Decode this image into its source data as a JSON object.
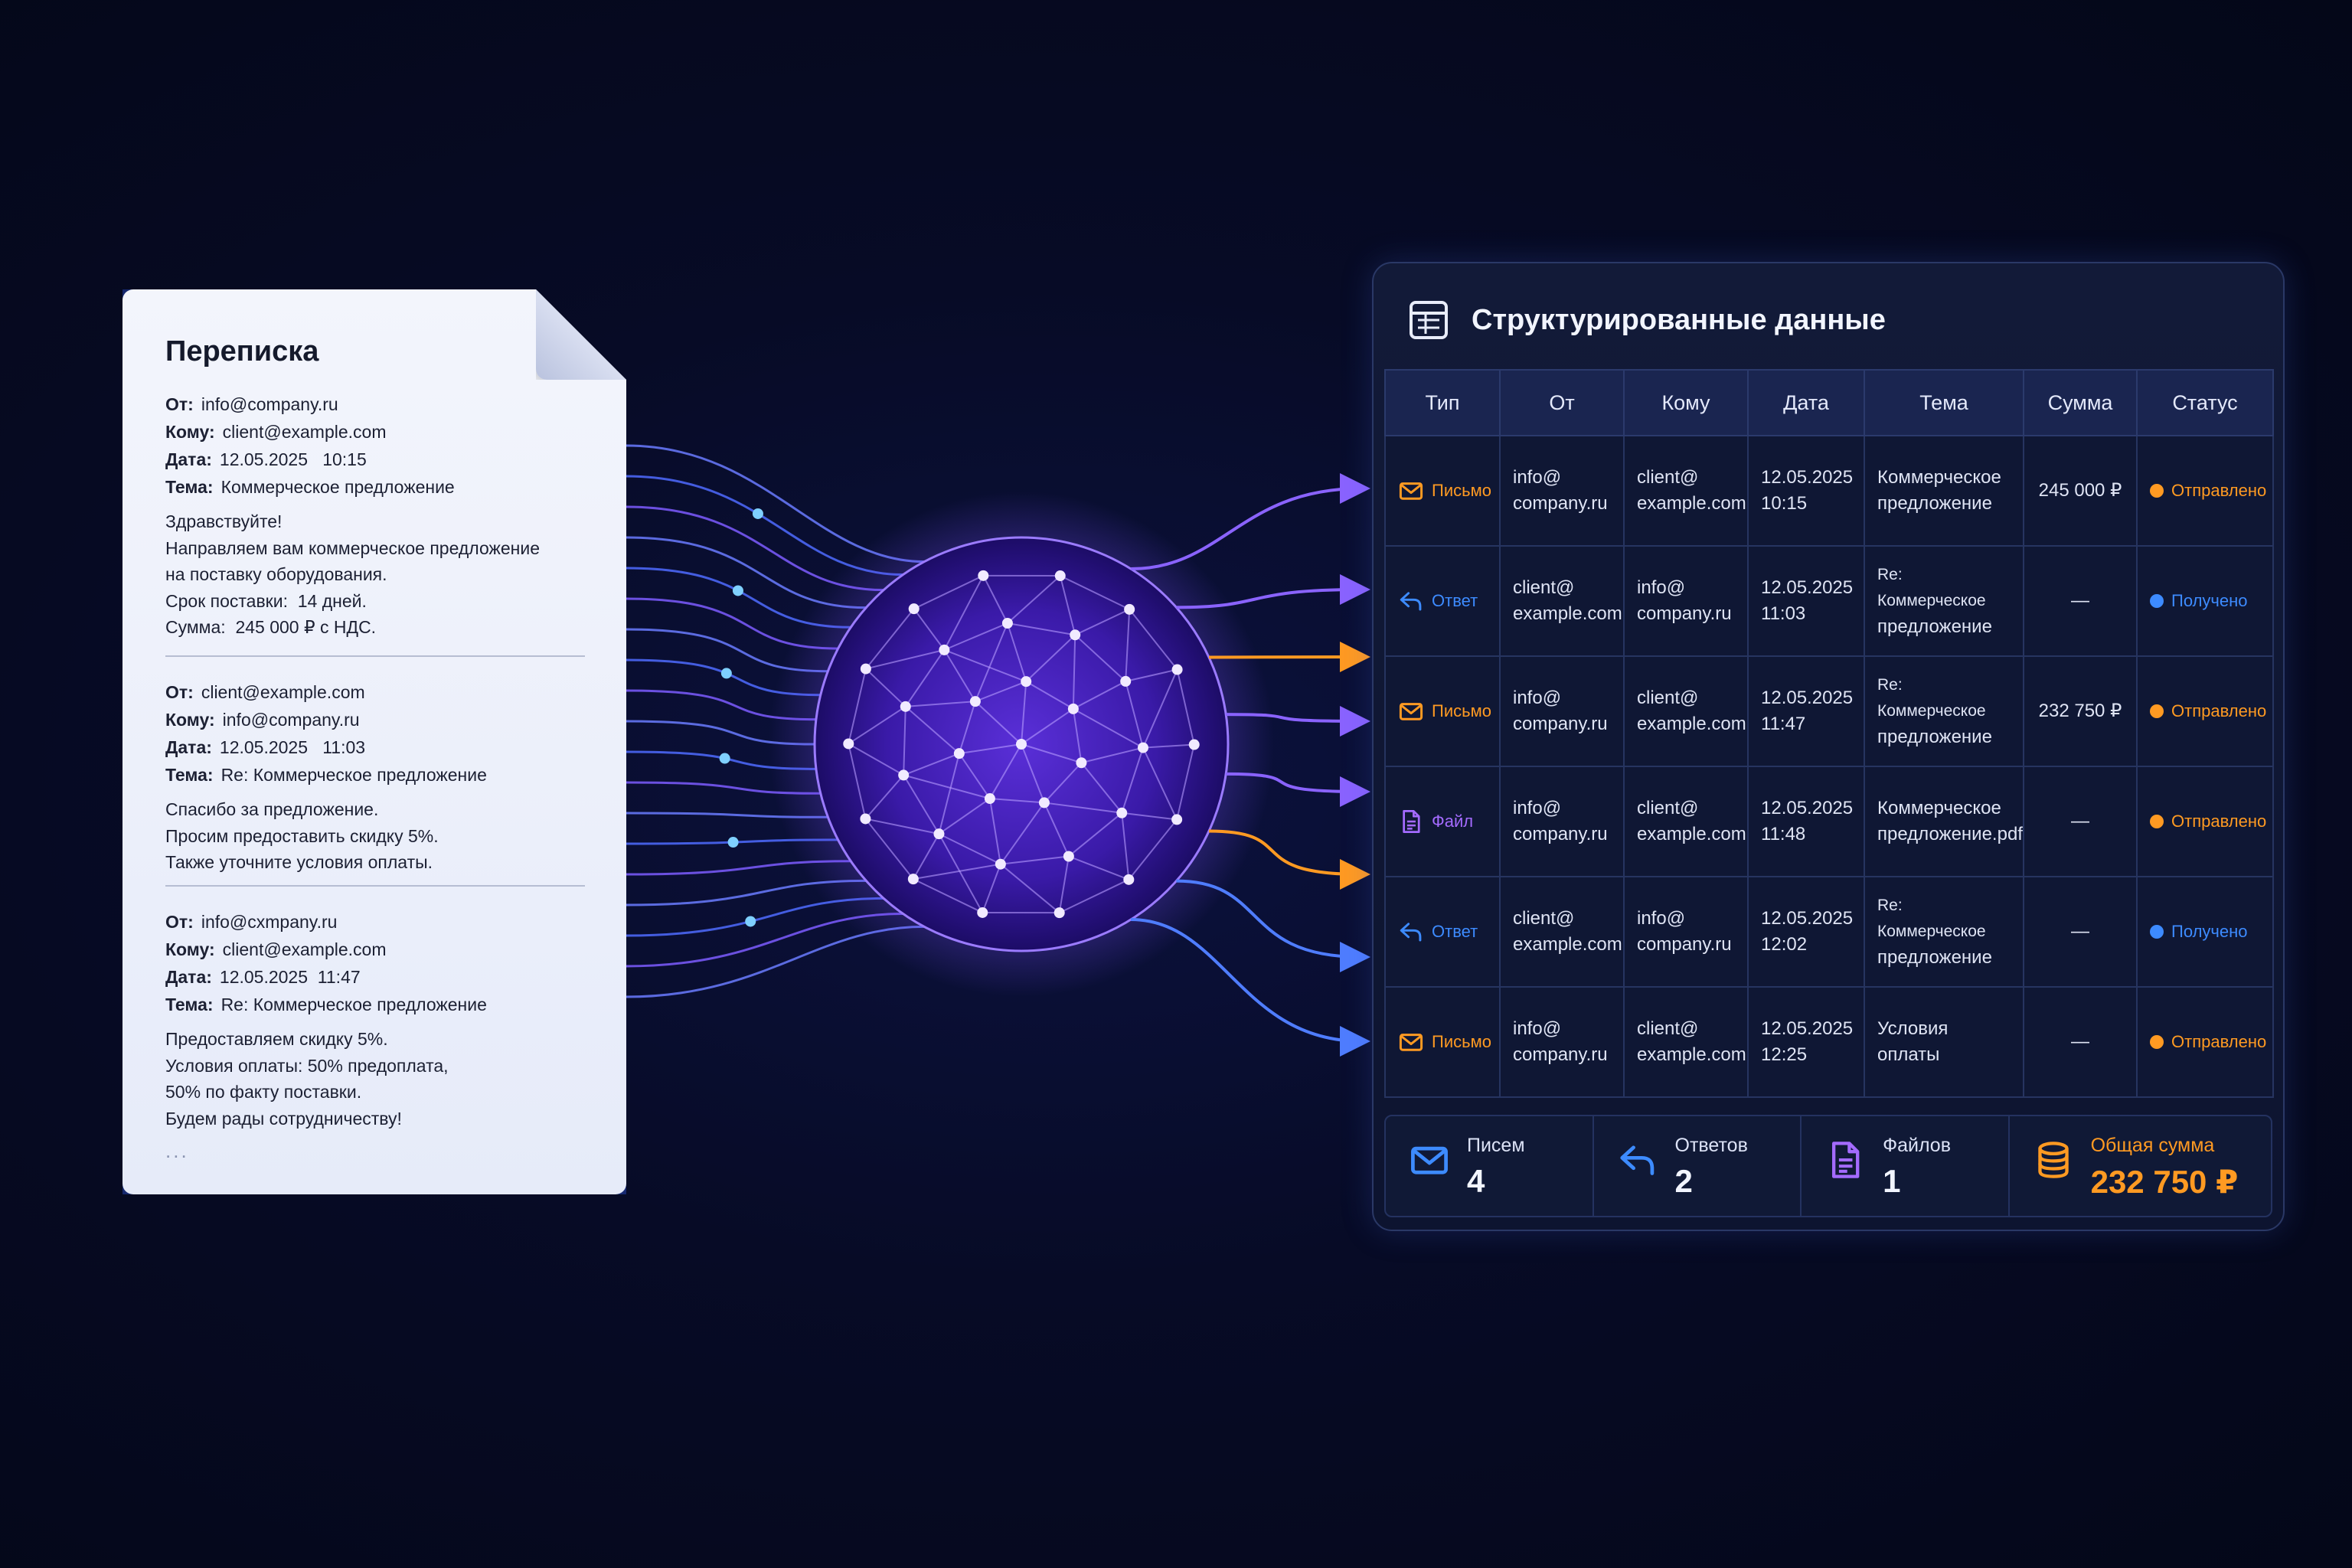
{
  "document": {
    "title": "Переписка",
    "messages": [
      {
        "from_label": "От:",
        "from": "info@company.ru",
        "to_label": "Кому:",
        "to": "client@example.com",
        "date_label": "Дата:",
        "date": "12.05.2025   10:15",
        "subject_label": "Тема:",
        "subject": "Коммерческое предложение",
        "body": [
          "Здравствуйте!",
          "Направляем вам коммерческое предложение",
          "на поставку оборудования.",
          "Срок поставки:  14 дней.",
          "Сумма:  245 000 ₽ с НДС."
        ]
      },
      {
        "from_label": "От:",
        "from": "client@example.com",
        "to_label": "Кому:",
        "to": "info@company.ru",
        "date_label": "Дата:",
        "date": "12.05.2025   11:03",
        "subject_label": "Тема:",
        "subject": "Re: Коммерческое предложение",
        "body": [
          "Спасибо за предложение.",
          "Просим предоставить скидку 5%.",
          "Также уточните условия оплаты."
        ]
      },
      {
        "from_label": "От:",
        "from": "info@cxmpany.ru",
        "to_label": "Кому:",
        "to": "client@example.com",
        "date_label": "Дата:",
        "date": "12.05.2025  11:47",
        "subject_label": "Тема:",
        "subject": "Re: Коммерческое предложение",
        "body": [
          "Предоставляем скидку 5%.",
          "Условия оплаты: 50% предоплата,",
          "50% по факту поставки.",
          "Будем рады сотрудничеству!"
        ]
      }
    ],
    "ellipsis": "..."
  },
  "panel": {
    "title": "Структурированные данные",
    "icon": "table-icon",
    "columns": [
      "Тип",
      "От",
      "Кому",
      "Дата",
      "Тема",
      "Сумма",
      "Статус"
    ],
    "rows": [
      {
        "type": "Письмо",
        "type_icon": "mail-icon",
        "type_color": "#ff9a22",
        "from": [
          "info@",
          "company.ru"
        ],
        "to": [
          "client@",
          "example.com"
        ],
        "date": [
          "12.05.2025",
          "10:15"
        ],
        "subject": [
          "Коммерческое",
          "предложение"
        ],
        "sum": "245 000 ₽",
        "status": "Отправлено",
        "status_color": "#ff9a22"
      },
      {
        "type": "Ответ",
        "type_icon": "reply-icon",
        "type_color": "#3d8bff",
        "from": [
          "client@",
          "example.com"
        ],
        "to": [
          "info@",
          "company.ru"
        ],
        "date": [
          "12.05.2025",
          "11:03"
        ],
        "subject": [
          "Re: Коммерческое",
          "предложение"
        ],
        "sum": "—",
        "status": "Получено",
        "status_color": "#3d8bff"
      },
      {
        "type": "Письмо",
        "type_icon": "mail-icon",
        "type_color": "#ff9a22",
        "from": [
          "info@",
          "company.ru"
        ],
        "to": [
          "client@",
          "example.com"
        ],
        "date": [
          "12.05.2025",
          "11:47"
        ],
        "subject": [
          "Re: Коммерческое",
          "предложение"
        ],
        "sum": "232 750 ₽",
        "status": "Отправлено",
        "status_color": "#ff9a22"
      },
      {
        "type": "Файл",
        "type_icon": "file-icon",
        "type_color": "#a46bff",
        "from": [
          "info@",
          "company.ru"
        ],
        "to": [
          "client@",
          "example.com"
        ],
        "date": [
          "12.05.2025",
          "11:48"
        ],
        "subject": [
          "Коммерческое",
          "предложение.pdf"
        ],
        "sum": "—",
        "status": "Отправлено",
        "status_color": "#ff9a22"
      },
      {
        "type": "Ответ",
        "type_icon": "reply-icon",
        "type_color": "#3d8bff",
        "from": [
          "client@",
          "example.com"
        ],
        "to": [
          "info@",
          "company.ru"
        ],
        "date": [
          "12.05.2025",
          "12:02"
        ],
        "subject": [
          "Re: Коммерческое",
          "предложение"
        ],
        "sum": "—",
        "status": "Получено",
        "status_color": "#3d8bff"
      },
      {
        "type": "Письмо",
        "type_icon": "mail-icon",
        "type_color": "#ff9a22",
        "from": [
          "info@",
          "company.ru"
        ],
        "to": [
          "client@",
          "example.com"
        ],
        "date": [
          "12.05.2025",
          "12:25"
        ],
        "subject": [
          "Условия оплаты"
        ],
        "sum": "—",
        "status": "Отправлено",
        "status_color": "#ff9a22"
      }
    ],
    "summary": [
      {
        "label": "Писем",
        "value": "4",
        "icon": "mail-icon",
        "color": "#3d8bff"
      },
      {
        "label": "Ответов",
        "value": "2",
        "icon": "reply-icon",
        "color": "#3d8bff"
      },
      {
        "label": "Файлов",
        "value": "1",
        "icon": "file-icon",
        "color": "#a46bff"
      },
      {
        "label": "Общая сумма",
        "value": "232 750 ₽",
        "icon": "coins-icon",
        "color": "#ff9a22"
      }
    ]
  },
  "colors": {
    "background": "#070b26",
    "accent_purple": "#7b4dff",
    "accent_orange": "#ff9a22",
    "accent_blue": "#3d8bff"
  }
}
